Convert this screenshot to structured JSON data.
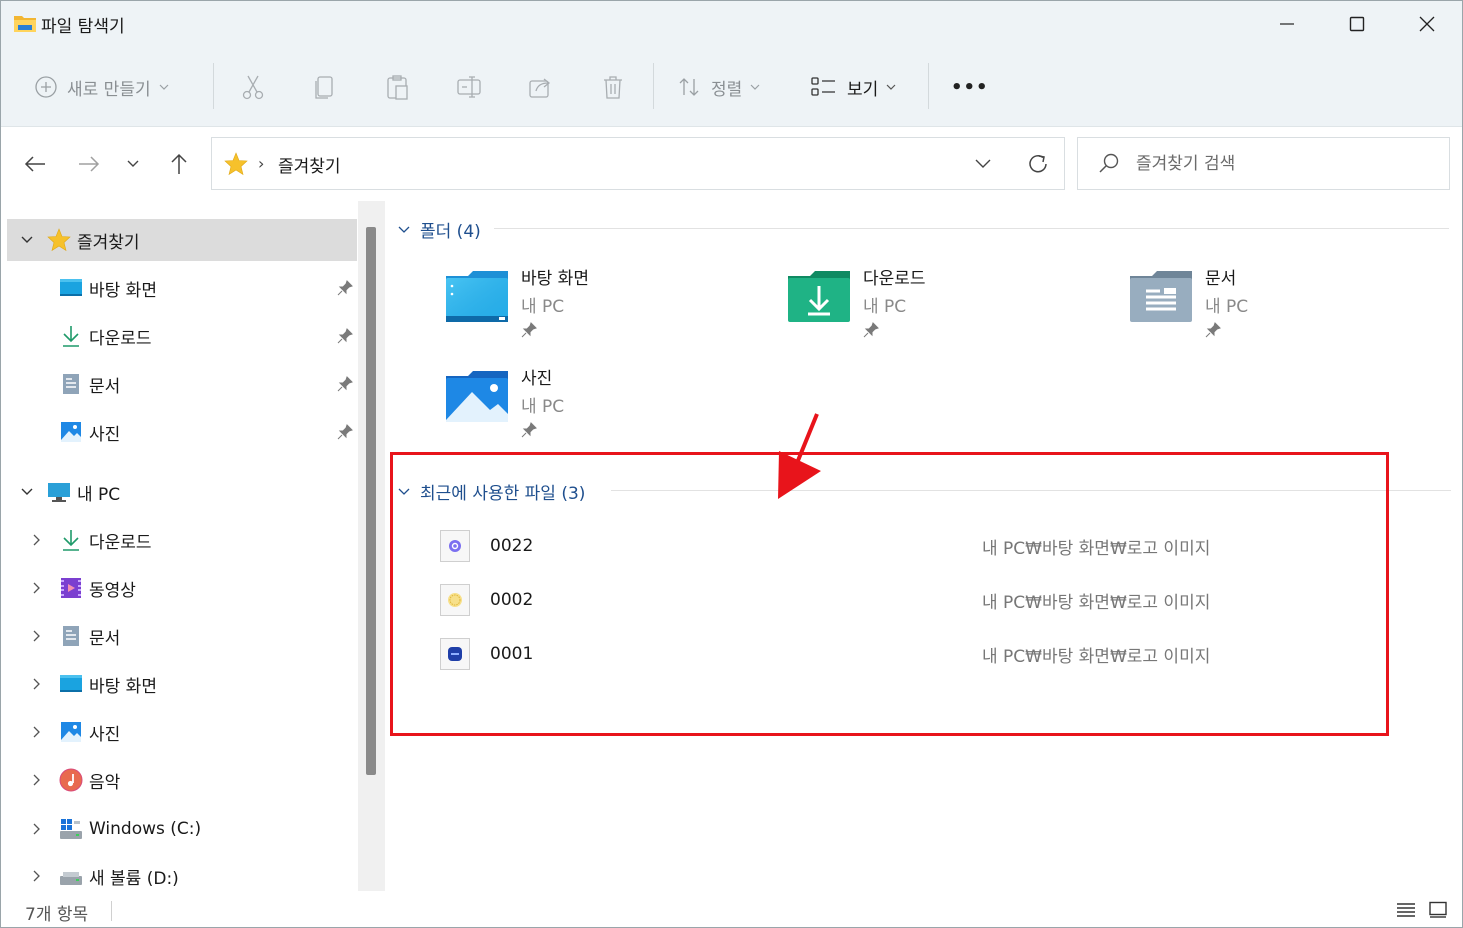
{
  "window": {
    "title": "파일 탐색기",
    "controls": {
      "minimize": "—",
      "maximize": "□",
      "close": "✕"
    }
  },
  "toolbar": {
    "new_label": "새로 만들기",
    "sort_label": "정렬",
    "view_label": "보기",
    "more_label": "•••"
  },
  "address": {
    "path": "즐겨찾기",
    "search_placeholder": "즐겨찾기 검색"
  },
  "sidebar": {
    "favorites_label": "즐겨찾기",
    "favorites": [
      {
        "label": "바탕 화면",
        "icon": "desktop-icon"
      },
      {
        "label": "다운로드",
        "icon": "download-icon"
      },
      {
        "label": "문서",
        "icon": "document-icon"
      },
      {
        "label": "사진",
        "icon": "pictures-icon"
      }
    ],
    "pc_label": "내 PC",
    "pc_items": [
      {
        "label": "다운로드",
        "icon": "download-icon"
      },
      {
        "label": "동영상",
        "icon": "video-icon"
      },
      {
        "label": "문서",
        "icon": "document-icon"
      },
      {
        "label": "바탕 화면",
        "icon": "desktop-icon"
      },
      {
        "label": "사진",
        "icon": "pictures-icon"
      },
      {
        "label": "음악",
        "icon": "music-icon"
      },
      {
        "label": "Windows (C:)",
        "icon": "windows-drive-icon"
      },
      {
        "label": "새 볼륨 (D:)",
        "icon": "drive-icon"
      }
    ]
  },
  "folders_group": {
    "title": "폴더 (4)",
    "items": [
      {
        "name": "바탕 화면",
        "location": "내 PC",
        "icon": "desktop-folder-icon"
      },
      {
        "name": "다운로드",
        "location": "내 PC",
        "icon": "downloads-folder-icon"
      },
      {
        "name": "문서",
        "location": "내 PC",
        "icon": "documents-folder-icon"
      },
      {
        "name": "사진",
        "location": "내 PC",
        "icon": "pictures-folder-icon"
      }
    ]
  },
  "recent_group": {
    "title": "최근에 사용한 파일 (3)",
    "files": [
      {
        "name": "0022",
        "path": "내 PC₩바탕 화면₩로고 이미지",
        "color": "#7b6ff0"
      },
      {
        "name": "0002",
        "path": "내 PC₩바탕 화면₩로고 이미지",
        "color": "#f2c94c"
      },
      {
        "name": "0001",
        "path": "내 PC₩바탕 화면₩로고 이미지",
        "color": "#1f3fa8"
      }
    ]
  },
  "status": {
    "item_count": "7개 항목"
  },
  "colors": {
    "accent": "#1f4f8e",
    "highlight": "#e8141b",
    "selected": "#dcdcdc"
  }
}
